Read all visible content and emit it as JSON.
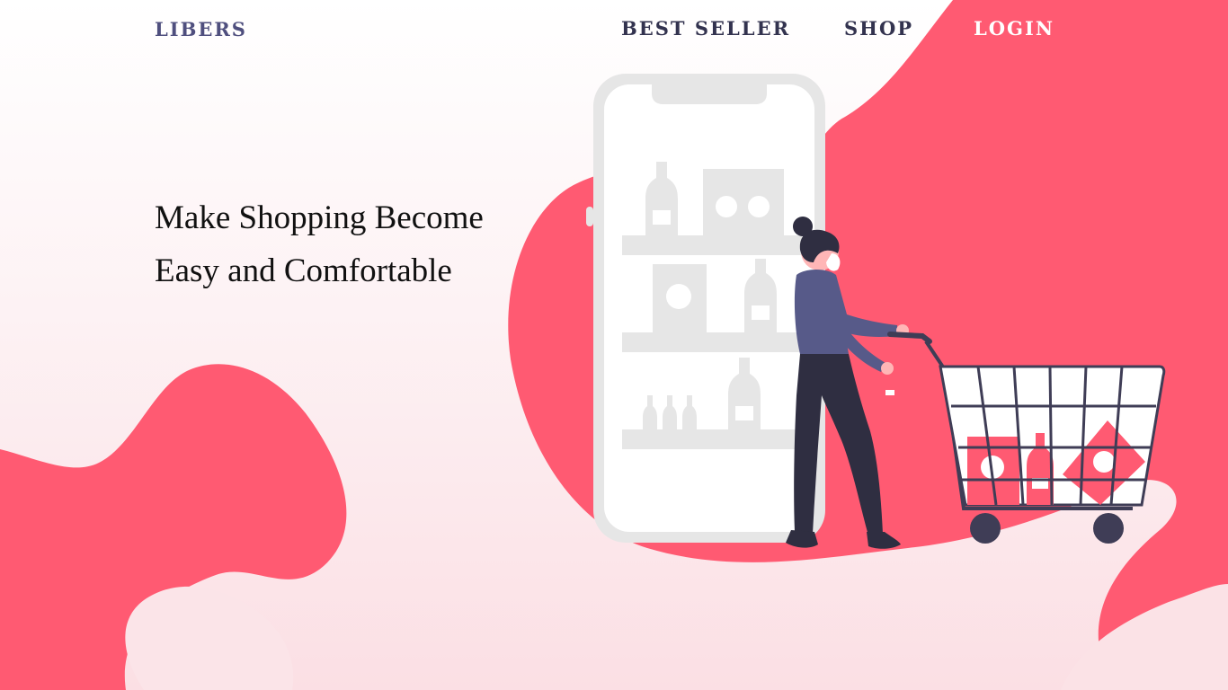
{
  "brand": {
    "name": "LIBERS"
  },
  "nav": {
    "items": [
      {
        "label": "BEST SELLER"
      },
      {
        "label": "SHOP"
      },
      {
        "label": "LOGIN"
      }
    ]
  },
  "hero": {
    "line1": "Make Shopping Become",
    "line2": "Easy and Comfortable"
  },
  "colors": {
    "accent": "#ff5a72",
    "navy": "#33334f",
    "brand": "#4f4f7e"
  }
}
